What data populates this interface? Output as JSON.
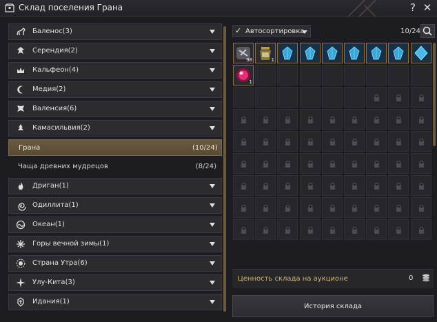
{
  "window": {
    "title": "Склад поселения Грана"
  },
  "controls": {
    "help": "?",
    "close": "✕"
  },
  "regions": [
    {
      "label": "Баленос(3)",
      "icon": "horse-icon"
    },
    {
      "label": "Серендия(2)",
      "icon": "eagle-icon"
    },
    {
      "label": "Кальфеон(4)",
      "icon": "crown-icon"
    },
    {
      "label": "Медия(2)",
      "icon": "moon-icon"
    },
    {
      "label": "Валенсия(6)",
      "icon": "wings-icon"
    },
    {
      "label": "Камасильвия(2)",
      "icon": "tree-icon"
    }
  ],
  "settlements": [
    {
      "label": "Грана",
      "count": "(10/24)",
      "active": true
    },
    {
      "label": "Чаща древних мудрецов",
      "count": "(8/24)",
      "active": false
    }
  ],
  "regions_bottom": [
    {
      "label": "Дриган(1)",
      "icon": "flame-icon"
    },
    {
      "label": "Одиллита(1)",
      "icon": "spiral-icon"
    },
    {
      "label": "Океан(1)",
      "icon": "wave-icon"
    },
    {
      "label": "Горы вечной зимы(1)",
      "icon": "snowflake-icon"
    },
    {
      "label": "Страна Утра(6)",
      "icon": "sun-icon"
    },
    {
      "label": "Улу-Кита(3)",
      "icon": "compass-star-icon"
    },
    {
      "label": "Идания(1)",
      "icon": "emblem-icon"
    }
  ],
  "storage": {
    "autosort_label": "Автосортировка",
    "autosort_checked": "✓",
    "capacity": "10/24",
    "items": [
      {
        "icon": "ore-icon",
        "qty": "98"
      },
      {
        "icon": "potion-jar-icon",
        "qty": "1"
      },
      {
        "icon": "blue-crystal-icon",
        "qty": ""
      },
      {
        "icon": "blue-crystal-icon",
        "qty": ""
      },
      {
        "icon": "blue-crystal-icon",
        "qty": ""
      },
      {
        "icon": "blue-crystal-icon",
        "qty": ""
      },
      {
        "icon": "blue-crystal-icon",
        "qty": ""
      },
      {
        "icon": "blue-crystal-icon",
        "qty": ""
      },
      {
        "icon": "blue-gem-icon",
        "qty": ""
      },
      {
        "icon": "red-orb-icon",
        "qty": "1"
      }
    ],
    "unlocked_slots": 24,
    "total_slots": 81,
    "value_label": "Ценность склада на аукционе",
    "value": "0",
    "history_button": "История склада"
  },
  "colors": {
    "accent": "#6a5a40",
    "value_text": "#d6b572",
    "crystal": "#3aa6d8",
    "orb": "#e0307a"
  }
}
